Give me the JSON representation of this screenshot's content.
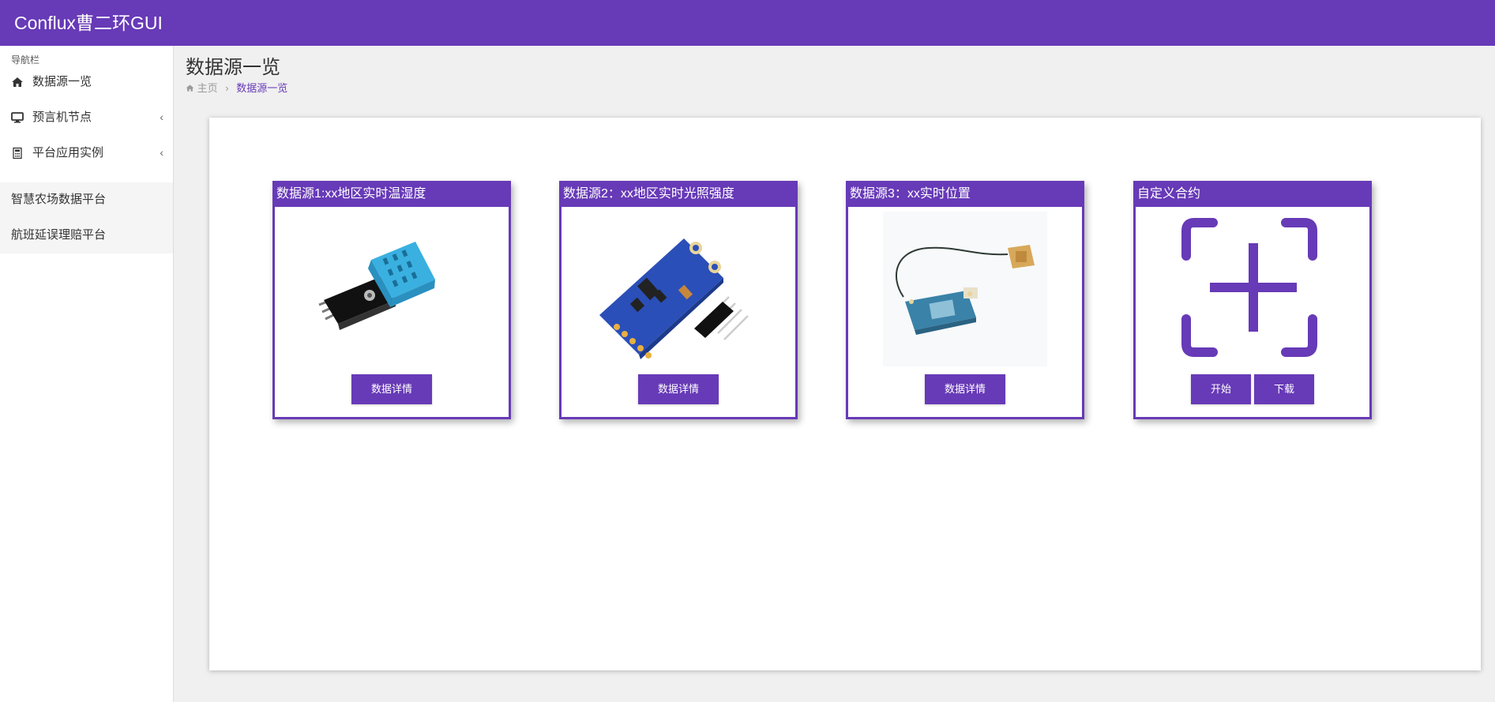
{
  "app": {
    "title": "Conflux曹二环GUI"
  },
  "sidebar": {
    "header": "导航栏",
    "items": [
      {
        "label": "数据源一览",
        "icon": "home-icon"
      },
      {
        "label": "预言机节点",
        "icon": "monitor-icon",
        "has_submenu": true
      },
      {
        "label": "平台应用实例",
        "icon": "calculator-icon",
        "has_submenu": true
      },
      {
        "label": "智慧农场数据平台"
      },
      {
        "label": "航班延误理赔平台"
      }
    ]
  },
  "page": {
    "title": "数据源一览",
    "breadcrumb": {
      "home": "主页",
      "current": "数据源一览"
    }
  },
  "cards": [
    {
      "title": "数据源1:xx地区实时温湿度",
      "image": "humidity-sensor-image",
      "button": "数据详情"
    },
    {
      "title": "数据源2：xx地区实时光照强度",
      "image": "light-sensor-image",
      "button": "数据详情"
    },
    {
      "title": "数据源3：xx实时位置",
      "image": "gps-module-image",
      "button": "数据详情"
    },
    {
      "title": "自定义合约",
      "image": "add-frame-icon",
      "buttons": [
        "开始",
        "下载"
      ]
    }
  ],
  "colors": {
    "accent": "#673ab7",
    "background": "#f0f0f0"
  }
}
